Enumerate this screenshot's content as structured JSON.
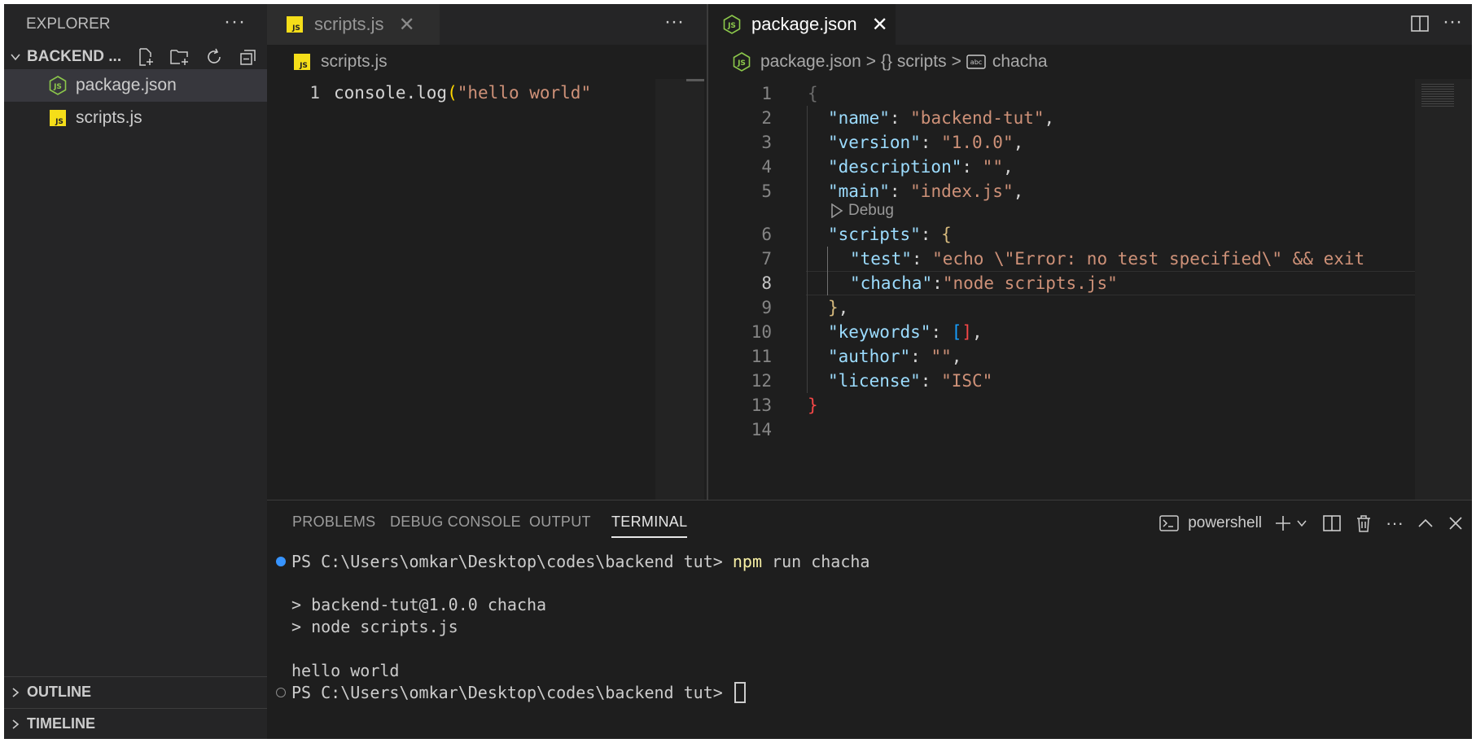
{
  "sidebar": {
    "title": "EXPLORER",
    "more": "···",
    "folder": "BACKEND ...",
    "files": [
      {
        "name": "package.json",
        "icon": "nodejs-icon",
        "selected": true
      },
      {
        "name": "scripts.js",
        "icon": "js-icon",
        "selected": false
      }
    ],
    "sections": {
      "outline": "OUTLINE",
      "timeline": "TIMELINE"
    }
  },
  "left_editor": {
    "tab": {
      "label": "scripts.js",
      "close": "✕"
    },
    "more": "···",
    "breadcrumb": "scripts.js",
    "code": {
      "ln": "1",
      "fn": "console.log",
      "paren": "(",
      "str": "\"hello world\""
    }
  },
  "right_editor": {
    "tab": {
      "label": "package.json",
      "close": "✕"
    },
    "more": "···",
    "breadcrumb": {
      "file": "package.json",
      "sep": ">",
      "seg1": "{} scripts",
      "seg2": "chacha"
    },
    "codelens": "Debug",
    "lines": [
      {
        "n": "1"
      },
      {
        "n": "2"
      },
      {
        "n": "3"
      },
      {
        "n": "4"
      },
      {
        "n": "5"
      },
      {
        "n": "6"
      },
      {
        "n": "7"
      },
      {
        "n": "8"
      },
      {
        "n": "9"
      },
      {
        "n": "10"
      },
      {
        "n": "11"
      },
      {
        "n": "12"
      },
      {
        "n": "13"
      },
      {
        "n": "14"
      }
    ],
    "text": {
      "l1": "{",
      "name_k": "\"name\"",
      "name_v": "\"backend-tut\"",
      "version_k": "\"version\"",
      "version_v": "\"1.0.0\"",
      "desc_k": "\"description\"",
      "desc_v": "\"\"",
      "main_k": "\"main\"",
      "main_v": "\"index.js\"",
      "scripts_k": "\"scripts\"",
      "scripts_open": "{",
      "test_k": "\"test\"",
      "test_v": "\"echo \\\"Error: no test specified\\\" && exit",
      "chacha_k": "\"chacha\"",
      "chacha_v": "\"node scripts.js\"",
      "scripts_close": "}",
      "keywords_k": "\"keywords\"",
      "arr_open": "[",
      "arr_close": "]",
      "author_k": "\"author\"",
      "author_v": "\"\"",
      "license_k": "\"license\"",
      "license_v": "\"ISC\"",
      "l13": "}",
      "colon": ": ",
      "colon_tight": ":",
      "comma": ","
    }
  },
  "panel": {
    "tabs": [
      "PROBLEMS",
      "DEBUG CONSOLE",
      "OUTPUT",
      "TERMINAL"
    ],
    "active_tab": "TERMINAL",
    "shell": "powershell",
    "more": "···",
    "terminal": {
      "prompt1": "PS C:\\Users\\omkar\\Desktop\\codes\\backend tut> ",
      "cmd_npm": "npm",
      "cmd_rest": " run chacha",
      "out1": "> backend-tut@1.0.0 chacha",
      "out2": "> node scripts.js",
      "out3": "hello world",
      "prompt2": "PS C:\\Users\\omkar\\Desktop\\codes\\backend tut> "
    }
  },
  "colors": {
    "editor_bg": "#1e1e1e",
    "sidebar_bg": "#252526",
    "js_yellow": "#f5de19",
    "node_green": "#8cc84b",
    "string": "#ce9178",
    "key": "#9cdcfe",
    "terminal_dot_active": "#3794ff"
  }
}
